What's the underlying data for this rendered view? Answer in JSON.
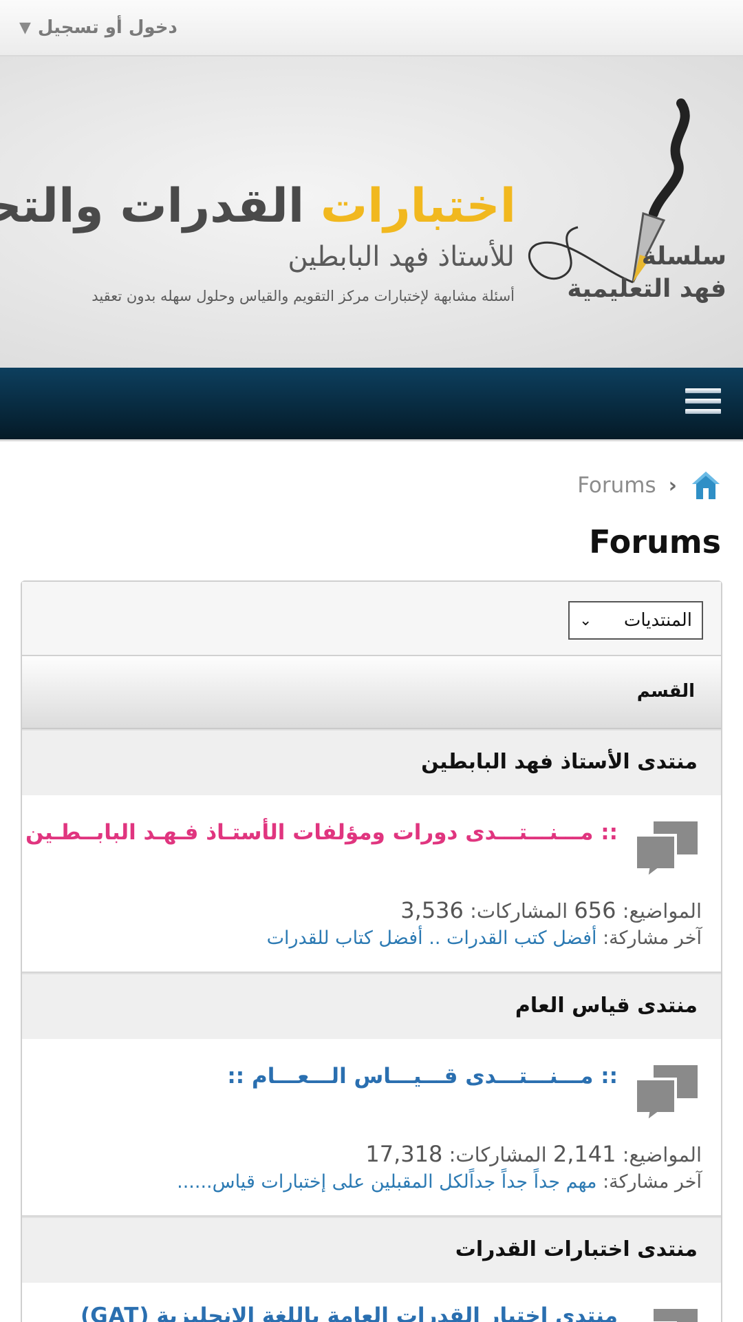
{
  "header": {
    "login_label": "دخول أو تسجيل",
    "login_caret": "▼"
  },
  "banner": {
    "title_highlight": "اختبارات",
    "title_rest": " القدرات والتحصيل",
    "subtitle": "للأستاذ فهد البابطين",
    "description": "أسئلة مشابهة لإختبارات مركز التقويم والقياس وحلول سهله بدون تعقيد",
    "series_line1": "سلسلة",
    "series_line2": "فهد التعليمية",
    "highlight_color": "#f1b81f"
  },
  "nav": {
    "menu_icon": "hamburger-icon"
  },
  "breadcrumb": {
    "home_icon": "home-icon",
    "separator": "‹",
    "link": "Forums"
  },
  "page": {
    "title": "Forums"
  },
  "filter": {
    "selected": "المنتديات",
    "caret": "⌄"
  },
  "table": {
    "column_header": "القسم"
  },
  "categories": [
    {
      "title": "منتدى الأستاذ فهد البابطين",
      "forums": [
        {
          "title": ":: مـــنـــتـــدى دورات ومؤلفات الأستـاذ فـهـد البابــطـين",
          "title_color": "#e0357f",
          "topics_label": "المواضيع:",
          "topics": "656",
          "posts_label": "المشاركات:",
          "posts": "3,536",
          "last_label": "آخر مشاركة:",
          "last_post": "أفضل كتب القدرات .. أفضل كتاب للقدرات"
        }
      ]
    },
    {
      "title": "منتدى قياس العام",
      "forums": [
        {
          "title": ":: مـــنـــتـــدى قـــيـــاس الـــعـــام ::",
          "title_color": "#2a6fb0",
          "topics_label": "المواضيع:",
          "topics": "2,141",
          "posts_label": "المشاركات:",
          "posts": "17,318",
          "last_label": "آخر مشاركة:",
          "last_post": "مهم جداً جداً جداًلكل المقبلين على إختبارات قياس......"
        }
      ]
    },
    {
      "title": "منتدى اختبارات القدرات",
      "forums": [
        {
          "title": "منتدى اختبار القدرات العامة باللغة الانجليزية (GAT)",
          "title_color": "#2a6fb0"
        }
      ]
    }
  ]
}
